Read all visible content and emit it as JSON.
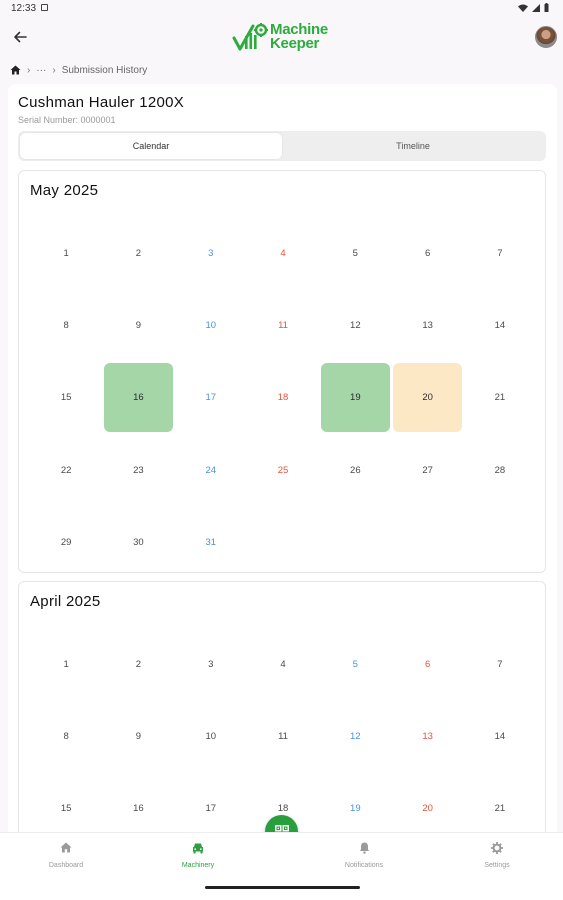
{
  "status_bar": {
    "time": "12:33"
  },
  "app_bar": {
    "logo_line1": "Machine",
    "logo_line2": "Keeper"
  },
  "breadcrumb": {
    "ellipsis": "···",
    "current": "Submission History"
  },
  "machine": {
    "name": "Cushman Hauler 1200X",
    "serial": "Serial Number: 0000001"
  },
  "tabs": [
    {
      "label": "Calendar",
      "active": true
    },
    {
      "label": "Timeline",
      "active": false
    }
  ],
  "calendars": [
    {
      "title": "May 2025",
      "days": [
        {
          "n": "1"
        },
        {
          "n": "2"
        },
        {
          "n": "3",
          "t": "sat"
        },
        {
          "n": "4",
          "t": "sun"
        },
        {
          "n": "5"
        },
        {
          "n": "6"
        },
        {
          "n": "7"
        },
        {
          "n": "8"
        },
        {
          "n": "9"
        },
        {
          "n": "10",
          "t": "sat"
        },
        {
          "n": "11",
          "t": "sun"
        },
        {
          "n": "12"
        },
        {
          "n": "13"
        },
        {
          "n": "14"
        },
        {
          "n": "15"
        },
        {
          "n": "16",
          "h": "green"
        },
        {
          "n": "17",
          "t": "sat"
        },
        {
          "n": "18",
          "t": "sun"
        },
        {
          "n": "19",
          "h": "green"
        },
        {
          "n": "20",
          "h": "orange"
        },
        {
          "n": "21"
        },
        {
          "n": "22"
        },
        {
          "n": "23"
        },
        {
          "n": "24",
          "t": "sat"
        },
        {
          "n": "25",
          "t": "sun"
        },
        {
          "n": "26"
        },
        {
          "n": "27"
        },
        {
          "n": "28"
        },
        {
          "n": "29"
        },
        {
          "n": "30"
        },
        {
          "n": "31",
          "t": "sat"
        }
      ]
    },
    {
      "title": "April 2025",
      "days": [
        {
          "n": "1"
        },
        {
          "n": "2"
        },
        {
          "n": "3"
        },
        {
          "n": "4"
        },
        {
          "n": "5",
          "t": "sat"
        },
        {
          "n": "6",
          "t": "sun"
        },
        {
          "n": "7"
        },
        {
          "n": "8"
        },
        {
          "n": "9"
        },
        {
          "n": "10"
        },
        {
          "n": "11"
        },
        {
          "n": "12",
          "t": "sat"
        },
        {
          "n": "13",
          "t": "sun"
        },
        {
          "n": "14"
        },
        {
          "n": "15"
        },
        {
          "n": "16"
        },
        {
          "n": "17"
        },
        {
          "n": "18"
        },
        {
          "n": "19",
          "t": "sat"
        },
        {
          "n": "20",
          "t": "sun"
        },
        {
          "n": "21"
        }
      ]
    }
  ],
  "bottom_nav": [
    {
      "label": "Dashboard",
      "icon": "home-icon",
      "active": false
    },
    {
      "label": "Machinery",
      "icon": "vehicle-icon",
      "active": true
    },
    {
      "label": "Notifications",
      "icon": "bell-icon",
      "active": false
    },
    {
      "label": "Settings",
      "icon": "gear-icon",
      "active": false
    }
  ],
  "fab": {
    "icon": "qr-code-icon"
  },
  "colors": {
    "brand_green": "#2bac3c",
    "highlight_green": "#a5d6a7",
    "highlight_orange": "#fde8c6",
    "saturday_blue": "#4a90e2",
    "sunday_red": "#e5533d",
    "fab_green": "#2a9d3c"
  }
}
